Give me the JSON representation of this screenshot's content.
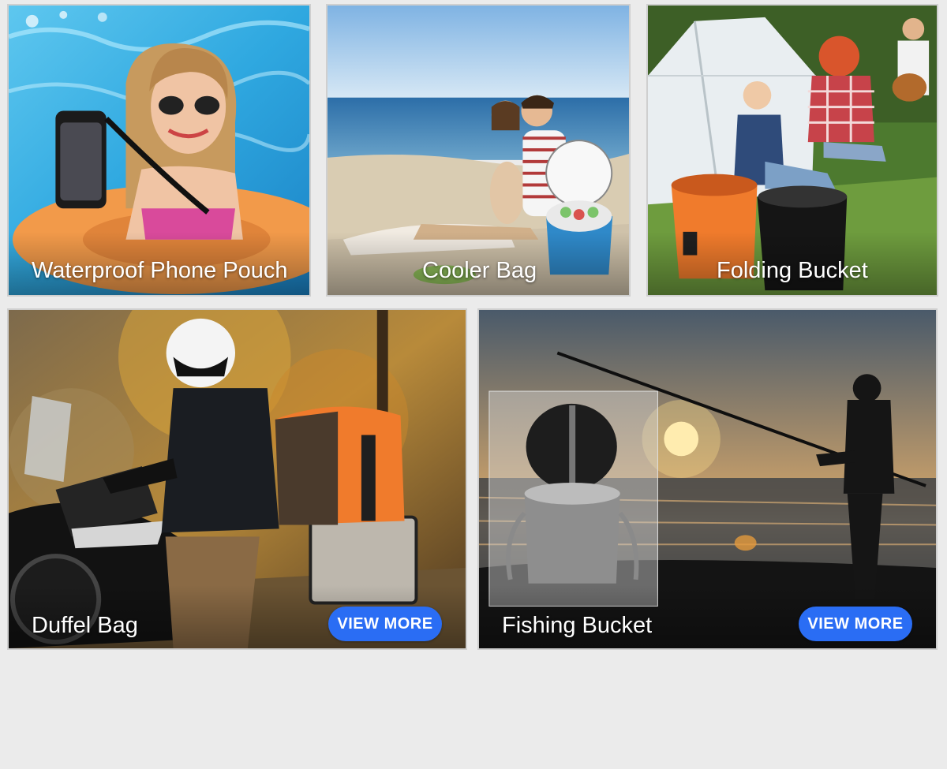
{
  "tiles": [
    {
      "id": "waterproof-phone-pouch",
      "title": "Waterproof Phone Pouch"
    },
    {
      "id": "cooler-bag",
      "title": "Cooler Bag"
    },
    {
      "id": "folding-bucket",
      "title": "Folding Bucket"
    },
    {
      "id": "duffel-bag",
      "title": "Duffel Bag",
      "button": "VIEW MORE"
    },
    {
      "id": "fishing-bucket",
      "title": "Fishing Bucket",
      "button": "VIEW MORE"
    }
  ],
  "colors": {
    "page_background": "#ebebeb",
    "button_background": "#2a6df4",
    "button_text": "#ffffff",
    "caption_text": "#ffffff"
  }
}
